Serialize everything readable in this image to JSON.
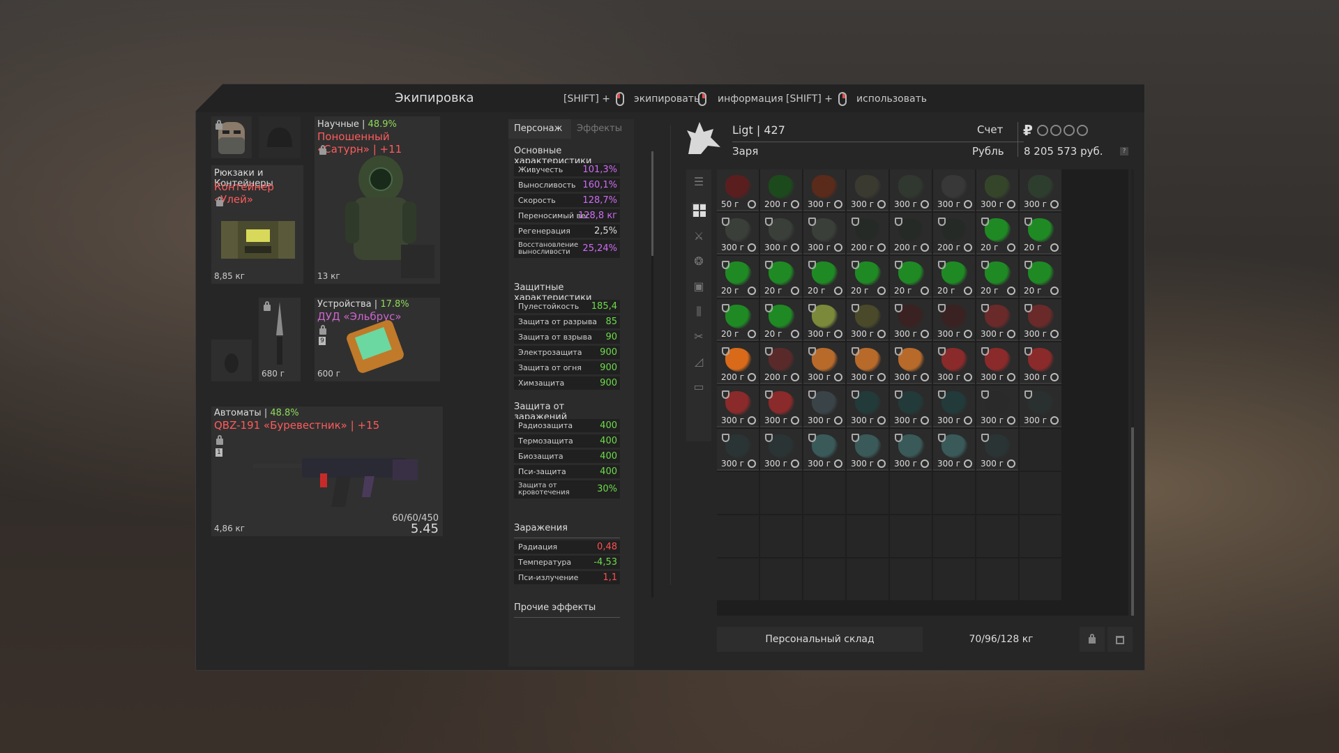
{
  "window": {
    "title": "Экипировка",
    "hints": [
      {
        "prefix": "[SHIFT] +",
        "label": "экипировать"
      },
      {
        "prefix": "",
        "label": "информация"
      },
      {
        "prefix": "[SHIFT] +",
        "label": "использовать"
      }
    ]
  },
  "equipment": {
    "backpack": {
      "category": "Рюкзаки и Контейнеры",
      "name": "Контейнер «Улей»",
      "weight": "8,85 кг"
    },
    "armor": {
      "category": "Научные",
      "percent": "48.9%",
      "name": "Поношенный «Сатурн» | +11",
      "weight": "13 кг"
    },
    "knife": {
      "weight": "680 г"
    },
    "device": {
      "category": "Устройства",
      "percent": "17.8%",
      "name": "ДУД «Эльбрус»",
      "weight": "600 г",
      "slot_number": "9"
    },
    "weapon": {
      "category": "Автоматы",
      "percent": "48.8%",
      "name": "QBZ-191 «Буревестник» | +15",
      "weight": "4,86 кг",
      "ammo": "60/60/450",
      "caliber": "5.45",
      "slot_number": "1"
    }
  },
  "stats_panel": {
    "tabs": [
      "Персонаж",
      "Эффекты"
    ],
    "sections": {
      "main": {
        "title": "Основные характеристики",
        "rows": [
          {
            "label": "Живучесть",
            "value": "101,3%"
          },
          {
            "label": "Выносливость",
            "value": "160,1%"
          },
          {
            "label": "Скорость",
            "value": "128,7%"
          },
          {
            "label": "Переносимый вес",
            "value": "128,8 кг"
          },
          {
            "label": "Регенерация",
            "value": "2,5%"
          },
          {
            "label": "Восстановление выносливости",
            "value": "25,24%"
          }
        ]
      },
      "protect": {
        "title": "Защитные характеристики",
        "rows": [
          {
            "label": "Пулестойкость",
            "value": "185,4"
          },
          {
            "label": "Защита от разрыва",
            "value": "85"
          },
          {
            "label": "Защита от взрыва",
            "value": "90"
          },
          {
            "label": "Электрозащита",
            "value": "900"
          },
          {
            "label": "Защита от огня",
            "value": "900"
          },
          {
            "label": "Химзащита",
            "value": "900"
          }
        ]
      },
      "infect": {
        "title": "Защита от заражений",
        "rows": [
          {
            "label": "Радиозащита",
            "value": "400"
          },
          {
            "label": "Термозащита",
            "value": "400"
          },
          {
            "label": "Биозащита",
            "value": "400"
          },
          {
            "label": "Пси-защита",
            "value": "400"
          },
          {
            "label": "Защита от кровотечения",
            "value": "30%"
          }
        ]
      },
      "contam": {
        "title": "Заражения",
        "rows": [
          {
            "label": "Радиация",
            "value": "0,48"
          },
          {
            "label": "Температура",
            "value": "-4,53"
          },
          {
            "label": "Пси-излучение",
            "value": "1,1"
          }
        ]
      },
      "other": {
        "title": "Прочие эффекты"
      }
    }
  },
  "player": {
    "name": "Ligt | 427",
    "faction": "Заря",
    "account_label": "Счет",
    "currency_symbol": "₽",
    "currency_name": "Рубль",
    "money": "8 205 573 руб.",
    "help": "?"
  },
  "inventory": {
    "cells": [
      {
        "w": "50 г",
        "c": "#5a1e1e"
      },
      {
        "w": "200 г",
        "c": "#1c4a1c"
      },
      {
        "w": "300 г",
        "c": "#5a2a1a"
      },
      {
        "w": "300 г",
        "c": "#3a3a30"
      },
      {
        "w": "300 г",
        "c": "#303830"
      },
      {
        "w": "300 г",
        "c": "#383838"
      },
      {
        "w": "300 г",
        "c": "#35452a"
      },
      {
        "w": "300 г",
        "c": "#2e3e2e"
      },
      {
        "w": "300 г",
        "c": "#3a3f3a"
      },
      {
        "w": "300 г",
        "c": "#3a3f3a"
      },
      {
        "w": "300 г",
        "c": "#3a3f3a"
      },
      {
        "w": "200 г",
        "c": "#262a26"
      },
      {
        "w": "200 г",
        "c": "#262a26"
      },
      {
        "w": "200 г",
        "c": "#262a26"
      },
      {
        "w": "20 г",
        "c": "#1f8a24"
      },
      {
        "w": "20 г",
        "c": "#1f8a24"
      },
      {
        "w": "20 г",
        "c": "#1f8a24"
      },
      {
        "w": "20 г",
        "c": "#1f8a24"
      },
      {
        "w": "20 г",
        "c": "#1f8a24"
      },
      {
        "w": "20 г",
        "c": "#1f8a24"
      },
      {
        "w": "20 г",
        "c": "#1f8a24"
      },
      {
        "w": "20 г",
        "c": "#1f8a24"
      },
      {
        "w": "20 г",
        "c": "#1f8a24"
      },
      {
        "w": "20 г",
        "c": "#1f8a24"
      },
      {
        "w": "20 г",
        "c": "#1f8a24"
      },
      {
        "w": "20 г",
        "c": "#1f8a24"
      },
      {
        "w": "300 г",
        "c": "#7a8a3a"
      },
      {
        "w": "300 г",
        "c": "#4a4a2a"
      },
      {
        "w": "300 г",
        "c": "#3a2222"
      },
      {
        "w": "300 г",
        "c": "#3a2222"
      },
      {
        "w": "300 г",
        "c": "#6a2a2a"
      },
      {
        "w": "300 г",
        "c": "#6a2a2a"
      },
      {
        "w": "200 г",
        "c": "#d96a1a"
      },
      {
        "w": "200 г",
        "c": "#5a2a2a"
      },
      {
        "w": "300 г",
        "c": "#b86a2a"
      },
      {
        "w": "300 г",
        "c": "#b86a2a"
      },
      {
        "w": "300 г",
        "c": "#b86a2a"
      },
      {
        "w": "300 г",
        "c": "#8a2a2a"
      },
      {
        "w": "300 г",
        "c": "#8a2a2a"
      },
      {
        "w": "300 г",
        "c": "#8a2a2a"
      },
      {
        "w": "300 г",
        "c": "#8a2a2a"
      },
      {
        "w": "300 г",
        "c": "#8a2a2a"
      },
      {
        "w": "300 г",
        "c": "#3a4448"
      },
      {
        "w": "300 г",
        "c": "#223a3a"
      },
      {
        "w": "300 г",
        "c": "#223a3a"
      },
      {
        "w": "300 г",
        "c": "#223a3a"
      },
      {
        "w": "300 г",
        "c": "#2a2a2a"
      },
      {
        "w": "300 г",
        "c": "#2a3030"
      },
      {
        "w": "300 г",
        "c": "#2a3434"
      },
      {
        "w": "300 г",
        "c": "#2a3434"
      },
      {
        "w": "300 г",
        "c": "#3a5a5a"
      },
      {
        "w": "300 г",
        "c": "#3a5a5a"
      },
      {
        "w": "300 г",
        "c": "#3a5a5a"
      },
      {
        "w": "300 г",
        "c": "#3a5a5a"
      },
      {
        "w": "300 г",
        "c": "#2a3434"
      }
    ],
    "empty_count": 25,
    "storage_label": "Персональный склад",
    "capacity": "70/96/128 кг"
  }
}
